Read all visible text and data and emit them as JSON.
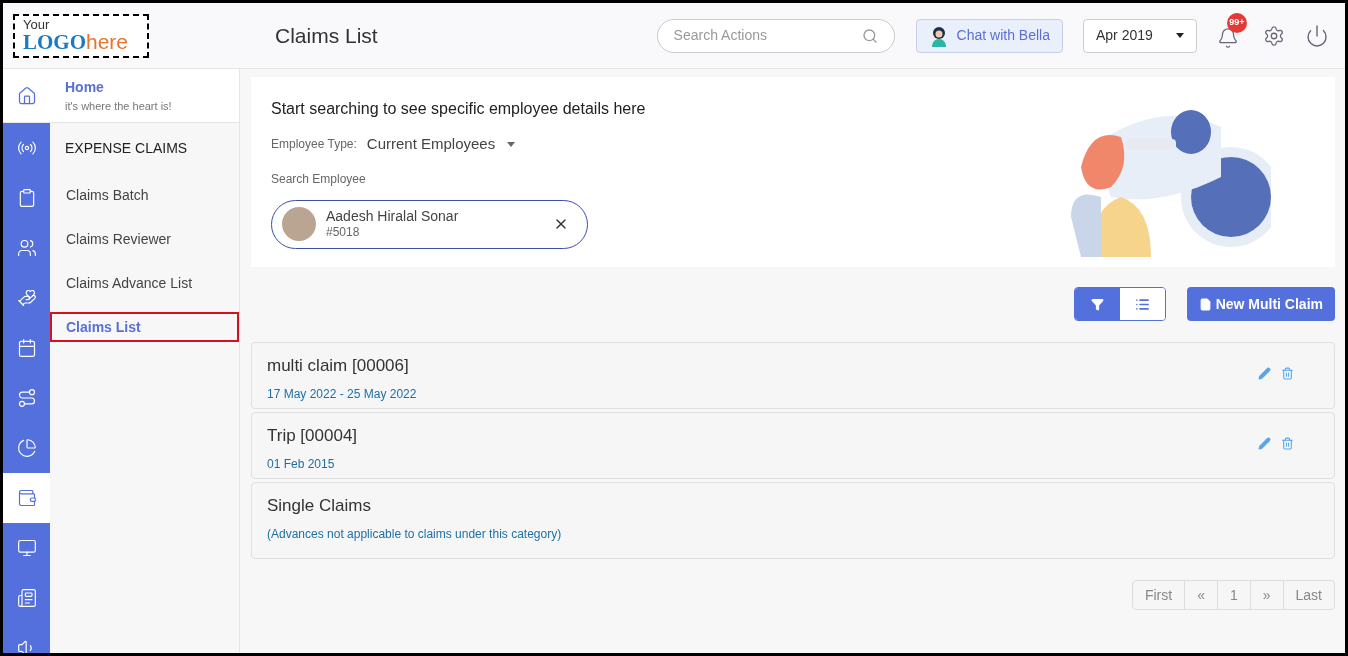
{
  "logo": {
    "line1": "Your",
    "brand": "LOGO",
    "suffix": "here"
  },
  "header": {
    "title": "Claims List",
    "search": {
      "placeholder": "Search Actions"
    },
    "chat_button": "Chat with Bella",
    "period": "Apr 2019",
    "notification_badge": "99+"
  },
  "home": {
    "label": "Home",
    "subtitle": "it's where the heart is!"
  },
  "rail": [
    {
      "selected": false
    },
    {
      "selected": false
    },
    {
      "selected": false
    },
    {
      "selected": false
    },
    {
      "selected": false
    },
    {
      "selected": false
    },
    {
      "selected": false
    },
    {
      "selected": true
    },
    {
      "selected": false
    },
    {
      "selected": false
    },
    {
      "selected": false
    }
  ],
  "submenu": {
    "heading": "EXPENSE CLAIMS",
    "items": [
      {
        "label": "Claims Batch",
        "selected": false
      },
      {
        "label": "Claims Reviewer",
        "selected": false
      },
      {
        "label": "Claims Advance List",
        "selected": false
      },
      {
        "label": "Claims List",
        "selected": true
      }
    ]
  },
  "search_panel": {
    "heading": "Start searching to see specific employee details here",
    "employee_type_label": "Employee Type:",
    "employee_type": "Current Employees",
    "search_label": "Search Employee",
    "employee": {
      "name": "Aadesh Hiralal Sonar",
      "id": "#5018"
    }
  },
  "view_toggle": [
    {
      "kind": "filter",
      "selected": true
    },
    {
      "kind": "list",
      "selected": false
    }
  ],
  "new_button": "New Multi Claim",
  "claims": [
    {
      "title": "multi claim [00006]",
      "subtitle": "17 May 2022 - 25 May 2022",
      "editable": true
    },
    {
      "title": "Trip [00004]",
      "subtitle": "01 Feb 2015",
      "editable": true
    },
    {
      "title": "Single Claims",
      "subtitle": "(Advances not applicable to claims under this category)",
      "editable": false
    }
  ],
  "pagination": [
    "First",
    "«",
    "1",
    "»",
    "Last"
  ]
}
